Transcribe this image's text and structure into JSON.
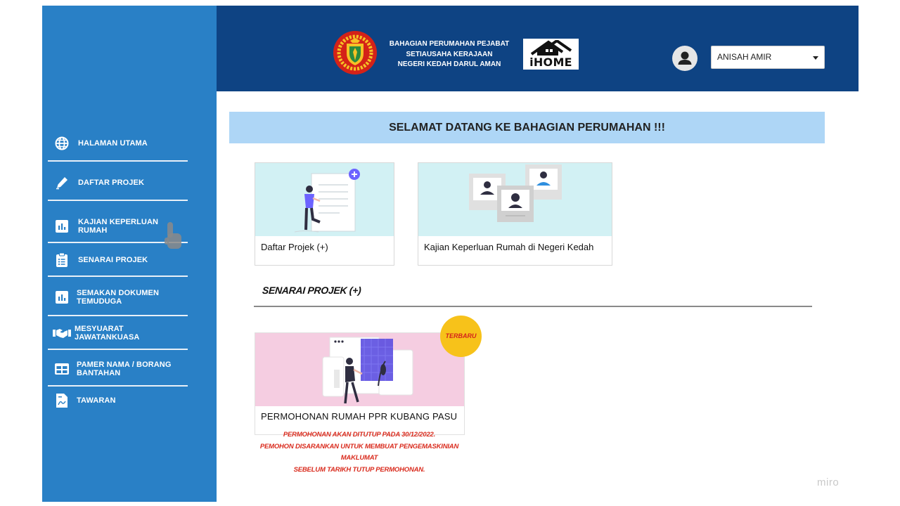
{
  "header": {
    "org_line1": "BAHAGIAN PERUMAHAN PEJABAT",
    "org_line2": "SETIAUSAHA KERAJAAN",
    "org_line3": "NEGERI KEDAH DARUL AMAN",
    "logo_text": "iHOME",
    "user_name": "ANISAH AMIR",
    "user_icon": "user-avatar-icon"
  },
  "sidebar": {
    "items": [
      {
        "label": "HALAMAN UTAMA",
        "icon": "globe-icon"
      },
      {
        "label": "DAFTAR PROJEK",
        "icon": "pen-icon"
      },
      {
        "label": "KAJIAN KEPERLUAN RUMAH",
        "icon": "bar-chart-icon"
      },
      {
        "label": "SENARAI PROJEK",
        "icon": "clipboard-list-icon"
      },
      {
        "label": "SEMAKAN DOKUMEN TEMUDUGA",
        "icon": "bar-chart-icon"
      },
      {
        "label": "MESYUARAT JAWATANKUASA",
        "icon": "handshake-icon"
      },
      {
        "label": "PAMER NAMA / BORANG BANTAHAN",
        "icon": "table-icon"
      },
      {
        "label": "TAWARAN",
        "icon": "document-icon"
      }
    ]
  },
  "main": {
    "welcome": "SELAMAT DATANG KE BAHAGIAN PERUMAHAN !!!",
    "cards": [
      {
        "caption": "Daftar Projek  (+)"
      },
      {
        "caption": "Kajian Keperluan Rumah di Negeri Kedah"
      }
    ],
    "section_title": "SENARAI PROJEK (+)",
    "project": {
      "badge": "TERBARU",
      "title": "PERMOHONAN RUMAH PPR KUBANG PASU",
      "notice_line1": "PERMOHONAN AKAN DITUTUP PADA 30/12/2022.",
      "notice_line2": "PEMOHON DISARANKAN UNTUK  MEMBUAT PENGEMASKINIAN MAKLUMAT",
      "notice_line3": "SEBELUM TARIKH TUTUP PERMOHONAN."
    }
  },
  "watermark": "miro",
  "colors": {
    "sidebar": "#2980c6",
    "header": "#0e4383",
    "welcome_bg": "#aed6f6",
    "badge": "#f7c21a",
    "notice": "#d92a1c"
  }
}
